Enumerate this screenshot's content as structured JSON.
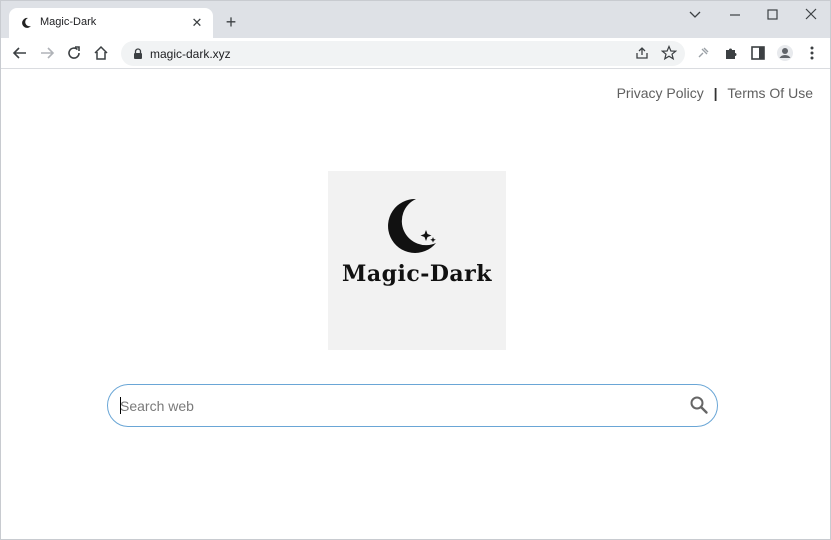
{
  "browser": {
    "tab": {
      "title": "Magic-Dark",
      "favicon": "moon-icon"
    },
    "address": {
      "url": "magic-dark.xyz"
    },
    "buttons": [
      "back-icon",
      "forward-icon",
      "reload-icon",
      "home-icon",
      "share-icon",
      "star-icon",
      "extension-pin-icon",
      "puzzle-icon",
      "side-panel-icon",
      "profile-icon",
      "menu-icon"
    ]
  },
  "page": {
    "links": {
      "privacy": "Privacy Policy",
      "separator": "|",
      "terms": "Terms Of Use"
    },
    "logo": {
      "text": "Magic-Dark"
    },
    "search": {
      "placeholder": "Search web",
      "value": ""
    }
  },
  "colors": {
    "tabstrip": "#dee1e6",
    "search_border": "#6aa6d6",
    "link": "#5f5f5f"
  }
}
